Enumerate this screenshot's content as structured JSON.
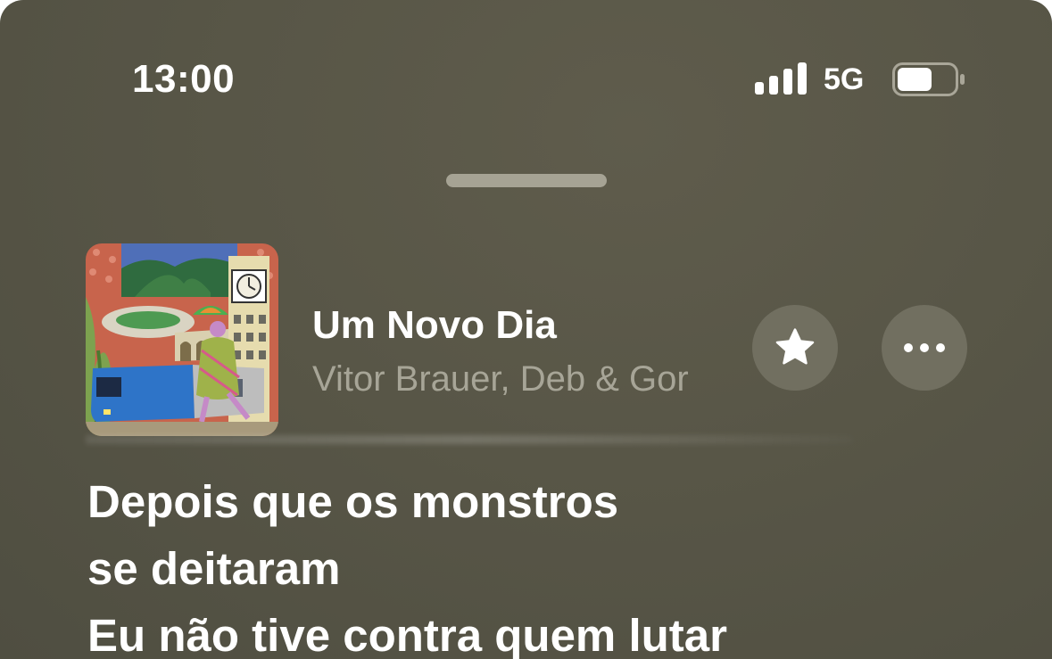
{
  "status_bar": {
    "time": "13:00",
    "network": "5G",
    "icons": [
      "cellular-signal-icon",
      "battery-icon"
    ]
  },
  "now_playing": {
    "title": "Um Novo Dia",
    "artist": "Vitor Brauer, Deb & Gor",
    "artwork_icon": "album-artwork"
  },
  "actions": {
    "favorite_icon": "star-icon",
    "more_icon": "ellipsis-icon"
  },
  "lyrics": {
    "lines": [
      "Depois que os monstros",
      "se deitaram",
      "Eu não tive contra quem lutar"
    ]
  },
  "colors": {
    "background": "#585647",
    "secondary_text": "#a7a597",
    "button_fill": "#716f60"
  }
}
